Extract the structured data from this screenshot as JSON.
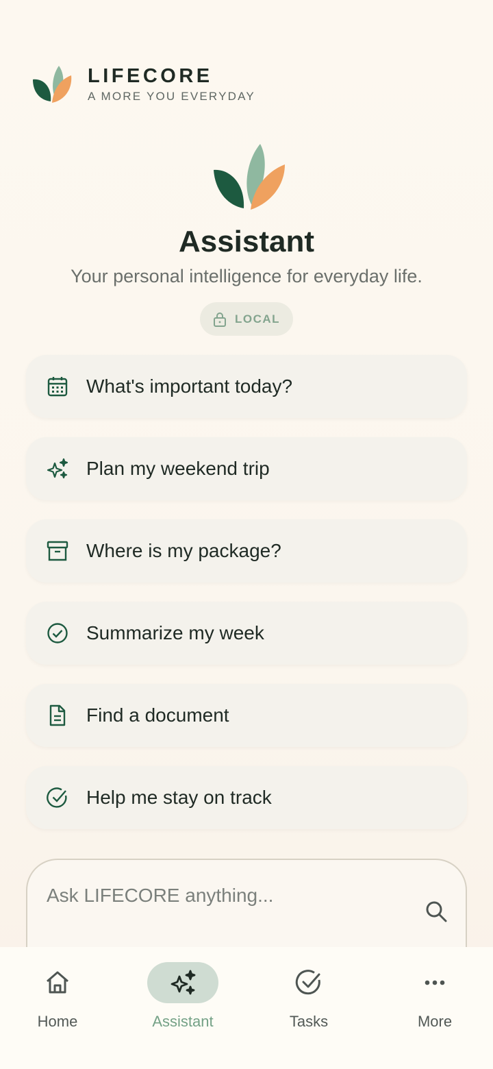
{
  "brand": {
    "name": "LIFECORE",
    "tagline": "A MORE YOU EVERYDAY"
  },
  "hero": {
    "title": "Assistant",
    "subtitle": "Your personal intelligence for everyday life.",
    "badge": "LOCAL",
    "badge_icon": "lock-icon"
  },
  "suggestions": [
    {
      "label": "What's important today?",
      "icon": "calendar-icon"
    },
    {
      "label": "Plan my weekend trip",
      "icon": "sparkle-icon"
    },
    {
      "label": "Where is my package?",
      "icon": "archive-box-icon"
    },
    {
      "label": "Summarize my week",
      "icon": "check-circle-icon"
    },
    {
      "label": "Find a document",
      "icon": "document-icon"
    },
    {
      "label": "Help me stay on track",
      "icon": "check-circle-icon"
    }
  ],
  "ask": {
    "placeholder": "Ask LIFECORE anything...",
    "value": ""
  },
  "nav": {
    "items": [
      {
        "label": "Home",
        "icon": "home-icon",
        "active": false
      },
      {
        "label": "Assistant",
        "icon": "sparkle-icon",
        "active": true
      },
      {
        "label": "Tasks",
        "icon": "check-circle-icon",
        "active": false
      },
      {
        "label": "More",
        "icon": "more-dots-icon",
        "active": false
      }
    ]
  },
  "colors": {
    "primary_dark_green": "#1d5a40",
    "leaf_sage": "#8fb8a0",
    "leaf_orange": "#efa15f",
    "active_nav_bg": "#cfdcd2",
    "active_nav_text": "#74a186"
  }
}
